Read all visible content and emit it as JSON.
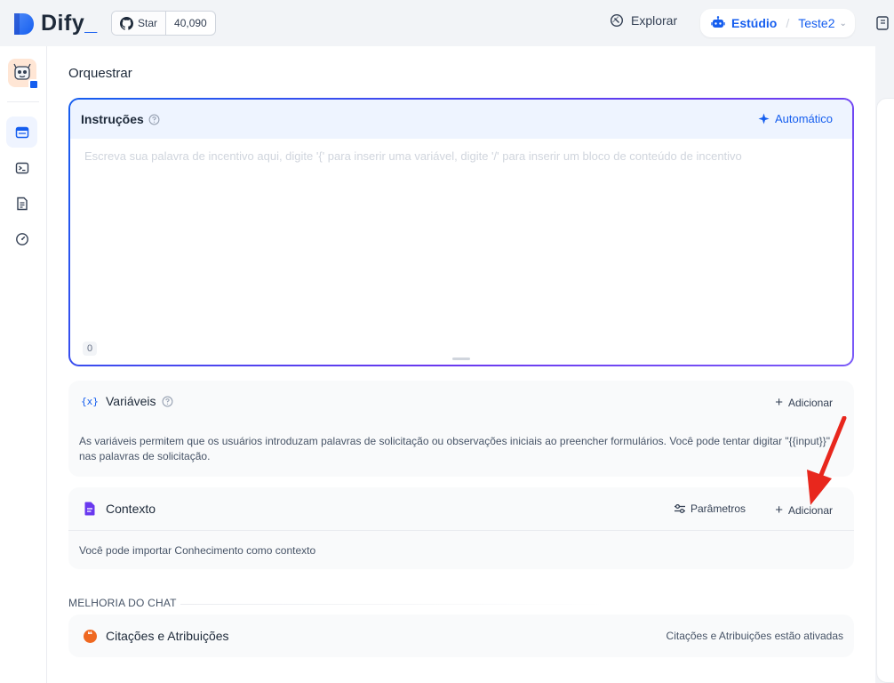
{
  "header": {
    "logo_text": "Dify",
    "github": {
      "star_label": "Star",
      "star_count": "40,090"
    },
    "nav": {
      "explore_label": "Explorar",
      "studio_label": "Estúdio",
      "app_name": "Teste2"
    }
  },
  "page": {
    "title": "Orquestrar"
  },
  "instructions": {
    "title": "Instruções",
    "auto_label": "Automático",
    "placeholder": "Escreva sua palavra de incentivo aqui, digite '{' para inserir uma variável, digite '/' para inserir um bloco de conteúdo de incentivo",
    "char_count": "0"
  },
  "variables": {
    "title": "Variáveis",
    "icon_text": "{x}",
    "add_label": "Adicionar",
    "description": "As variáveis permitem que os usuários introduzam palavras de solicitação ou observações iniciais ao preencher formulários. Você pode tentar digitar \"{{input}}\" nas palavras de solicitação."
  },
  "context": {
    "title": "Contexto",
    "params_label": "Parâmetros",
    "add_label": "Adicionar",
    "description": "Você pode importar Conhecimento como contexto"
  },
  "chat_enhancement": {
    "section_label": "MELHORIA DO CHAT",
    "citations": {
      "title": "Citações e Atribuições",
      "icon_text": "❝",
      "status": "Citações e Atribuições estão ativadas"
    }
  },
  "colors": {
    "primary": "#155eef",
    "purple": "#6938ef",
    "orange": "#ef6820",
    "annotation_arrow": "#e8271d"
  }
}
